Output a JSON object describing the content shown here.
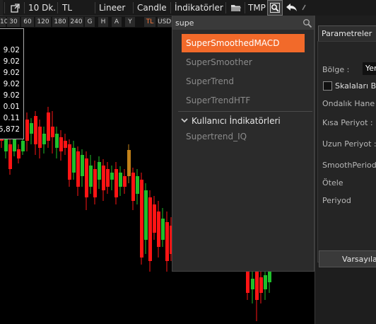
{
  "toolbar": {
    "period": "10 Dk.",
    "currency": "TL",
    "scale": "Lineer",
    "chart_type": "Candle",
    "indicators": "İndikatörler",
    "tmp": "TMP",
    "icons": [
      "external-link-icon",
      "folder-icon",
      "search-icon",
      "undo-icon",
      "pen-icon"
    ]
  },
  "periods": {
    "items": [
      "10",
      "30",
      "60",
      "120",
      "180",
      "240",
      "G",
      "H",
      "A",
      "Y"
    ],
    "currency_tl": "TL",
    "currency_usd": "USD"
  },
  "values": [
    "9.02",
    "9.02",
    "9.02",
    "9.02",
    "9.02",
    "0.01",
    "0.11",
    "5,872"
  ],
  "search": {
    "value": "supe",
    "placeholder": ""
  },
  "dropdown": {
    "items": [
      "SuperSmoothedMACD",
      "SuperSmoother",
      "SuperTrend",
      "SuperTrendHTF"
    ],
    "selected_index": 0,
    "group_label": "Kullanıcı İndikatörleri",
    "group_items": [
      "Supertrend_IQ"
    ]
  },
  "panel": {
    "tab": "Parametreler",
    "region_label": "Bölge :",
    "region_value": "Yeni",
    "separate_scale_label": "Skalaları Bi",
    "decimal_label": "Ondalık Hane S",
    "short_period_label": "Kısa Periyot :",
    "long_period_label": "Uzun Periyot :",
    "smooth_label": "SmoothPeriod",
    "shift_label": "Ötele",
    "period_label": "Periyod",
    "default_button": "Varsayılan"
  },
  "colors": {
    "up": "#1fbf2a",
    "down": "#ff1414",
    "accent": "#f26a2a",
    "shadow": "#c08018"
  }
}
